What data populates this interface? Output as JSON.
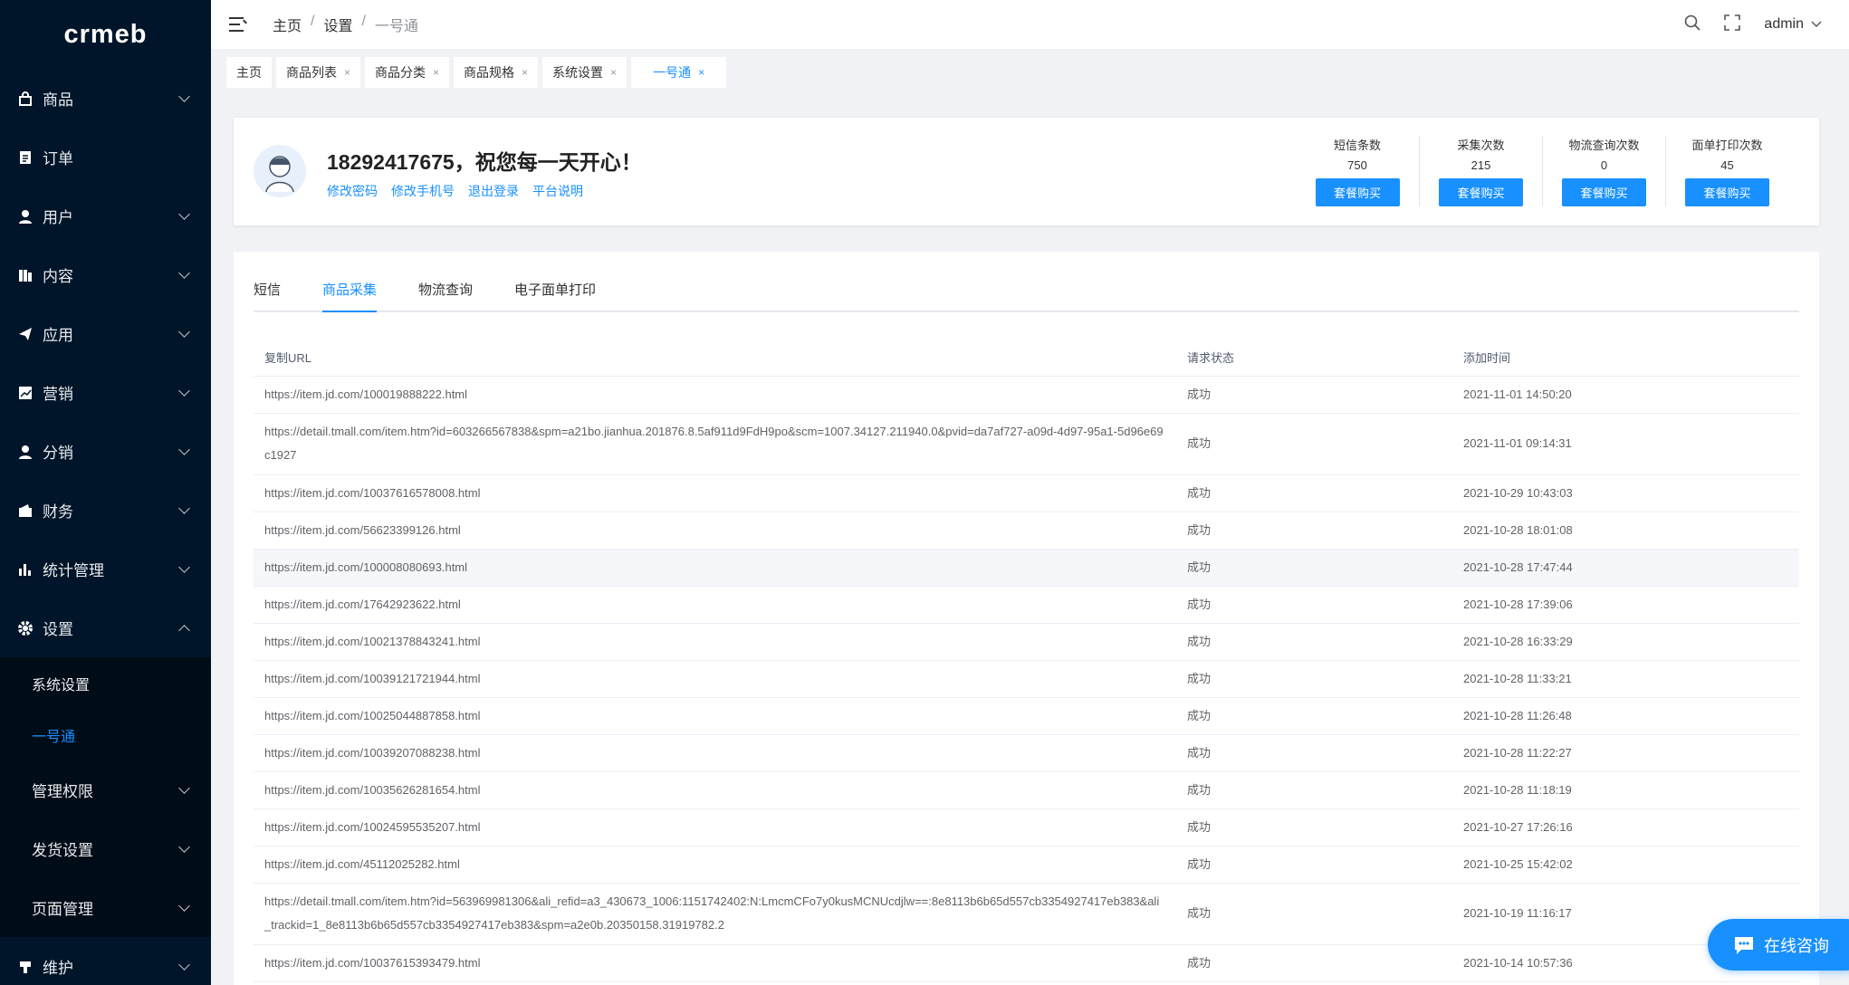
{
  "sidebar": {
    "logo": "crmeb",
    "items": [
      {
        "label": "商品",
        "icon": "bag-icon"
      },
      {
        "label": "订单",
        "icon": "order-icon"
      },
      {
        "label": "用户",
        "icon": "user-icon"
      },
      {
        "label": "内容",
        "icon": "content-icon"
      },
      {
        "label": "应用",
        "icon": "send-icon"
      },
      {
        "label": "营销",
        "icon": "chart-icon"
      },
      {
        "label": "分销",
        "icon": "user-icon"
      },
      {
        "label": "财务",
        "icon": "wallet-icon"
      },
      {
        "label": "统计管理",
        "icon": "bar-chart-icon"
      },
      {
        "label": "设置",
        "icon": "gear-icon"
      }
    ],
    "sub_items": [
      "系统设置",
      "一号通"
    ],
    "more_items": [
      "管理权限",
      "发货设置",
      "页面管理"
    ],
    "last_item": {
      "label": "维护",
      "icon": "tool-icon"
    }
  },
  "header": {
    "crumbs": [
      "主页",
      "设置",
      "一号通"
    ],
    "sep": "/",
    "user": "admin"
  },
  "tags": [
    {
      "label": "主页"
    },
    {
      "label": "商品列表"
    },
    {
      "label": "商品分类"
    },
    {
      "label": "商品规格"
    },
    {
      "label": "系统设置"
    },
    {
      "label": "一号通"
    }
  ],
  "profile": {
    "greeting": "18292417675，祝您每一天开心！",
    "links": [
      "修改密码",
      "修改手机号",
      "退出登录",
      "平台说明"
    ],
    "stats": [
      {
        "label": "短信条数",
        "value": "750",
        "button": "套餐购买"
      },
      {
        "label": "采集次数",
        "value": "215",
        "button": "套餐购买"
      },
      {
        "label": "物流查询次数",
        "value": "0",
        "button": "套餐购买"
      },
      {
        "label": "面单打印次数",
        "value": "45",
        "button": "套餐购买"
      }
    ]
  },
  "tabs": [
    "短信",
    "商品采集",
    "物流查询",
    "电子面单打印"
  ],
  "table": {
    "headers": [
      "复制URL",
      "请求状态",
      "添加时间"
    ],
    "rows": [
      {
        "url": "https://item.jd.com/100019888222.html",
        "status": "成功",
        "time": "2021-11-01 14:50:20"
      },
      {
        "url": "https://detail.tmall.com/item.htm?id=603266567838&spm=a21bo.jianhua.201876.8.5af911d9FdH9po&scm=1007.34127.211940.0&pvid=da7af727-a09d-4d97-95a1-5d96e69c1927",
        "status": "成功",
        "time": "2021-11-01 09:14:31"
      },
      {
        "url": "https://item.jd.com/10037616578008.html",
        "status": "成功",
        "time": "2021-10-29 10:43:03"
      },
      {
        "url": "https://item.jd.com/56623399126.html",
        "status": "成功",
        "time": "2021-10-28 18:01:08"
      },
      {
        "url": "https://item.jd.com/100008080693.html",
        "status": "成功",
        "time": "2021-10-28 17:47:44"
      },
      {
        "url": "https://item.jd.com/17642923622.html",
        "status": "成功",
        "time": "2021-10-28 17:39:06"
      },
      {
        "url": "https://item.jd.com/10021378843241.html",
        "status": "成功",
        "time": "2021-10-28 16:33:29"
      },
      {
        "url": "https://item.jd.com/10039121721944.html",
        "status": "成功",
        "time": "2021-10-28 11:33:21"
      },
      {
        "url": "https://item.jd.com/10025044887858.html",
        "status": "成功",
        "time": "2021-10-28 11:26:48"
      },
      {
        "url": "https://item.jd.com/10039207088238.html",
        "status": "成功",
        "time": "2021-10-28 11:22:27"
      },
      {
        "url": "https://item.jd.com/10035626281654.html",
        "status": "成功",
        "time": "2021-10-28 11:18:19"
      },
      {
        "url": "https://item.jd.com/10024595535207.html",
        "status": "成功",
        "time": "2021-10-27 17:26:16"
      },
      {
        "url": "https://item.jd.com/45112025282.html",
        "status": "成功",
        "time": "2021-10-25 15:42:02"
      },
      {
        "url": "https://detail.tmall.com/item.htm?id=563969981306&ali_refid=a3_430673_1006:1151742402:N:LmcmCFo7y0kusMCNUcdjlw==:8e8113b6b65d557cb3354927417eb383&ali_trackid=1_8e8113b6b65d557cb3354927417eb383&spm=a2e0b.20350158.31919782.2",
        "status": "成功",
        "time": "2021-10-19 11:16:17"
      },
      {
        "url": "https://item.jd.com/10037615393479.html",
        "status": "成功",
        "time": "2021-10-14 10:57:36"
      }
    ]
  },
  "consult": "在线咨询"
}
